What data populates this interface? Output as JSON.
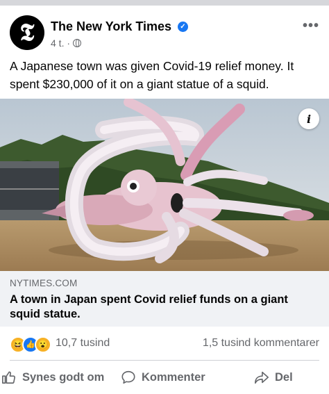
{
  "post": {
    "page_name": "The New York Times",
    "avatar_letter": "𝕿",
    "time": "4 t. ·",
    "text": "A Japanese town was given Covid-19 relief money. It spent $230,000 of it on a giant statue of a squid.",
    "info_glyph": "i",
    "more_glyph": "•••"
  },
  "link": {
    "domain": "NYTIMES.COM",
    "headline": "A town in Japan spent Covid relief funds on a giant squid statue."
  },
  "stats": {
    "reaction_count": "10,7 tusind",
    "comments": "1,5 tusind kommentarer",
    "reactions": [
      "haha",
      "like",
      "wow"
    ]
  },
  "actions": {
    "like": "Synes godt om",
    "comment": "Kommenter",
    "share": "Del"
  },
  "colors": {
    "accent": "#1877f2",
    "secondary_text": "#65676b",
    "link_box_bg": "#f0f2f5"
  }
}
